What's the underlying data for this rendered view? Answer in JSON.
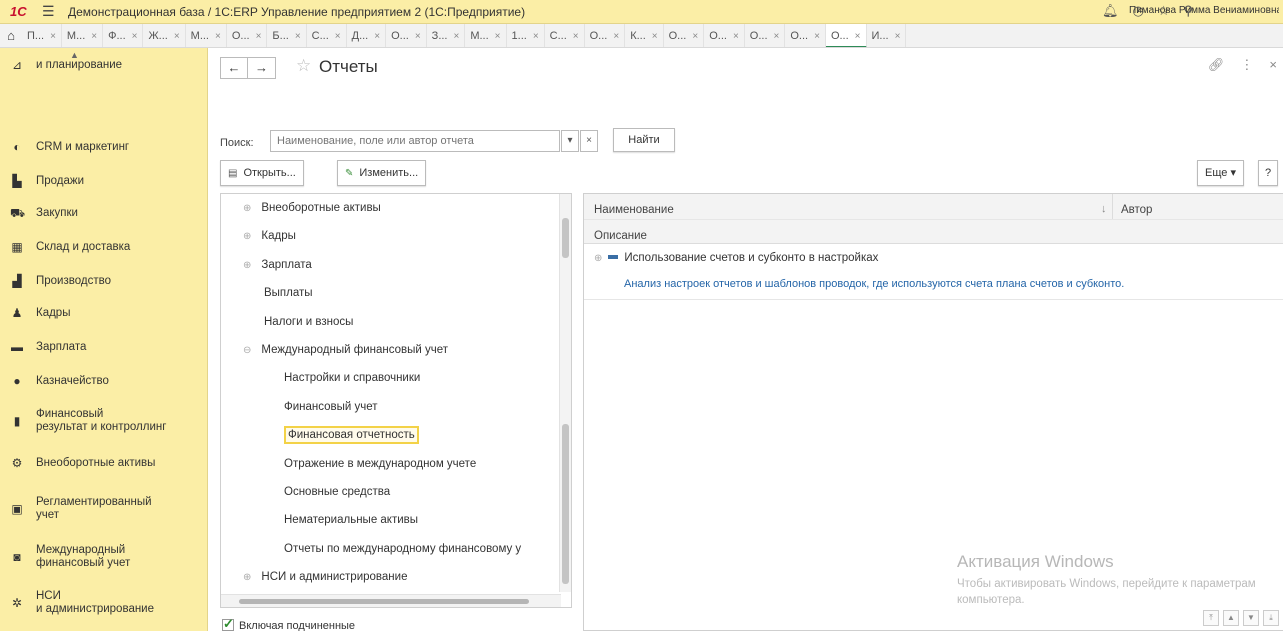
{
  "window": {
    "logo": "1С",
    "title": "Демонстрационная база / 1С:ERP Управление предприятием 2  (1С:Предприятие)",
    "user": "Пиманова Римма Вениаминовна"
  },
  "tabs": [
    "П...",
    "М...",
    "Ф...",
    "Ж...",
    "М...",
    "О...",
    "Б...",
    "С...",
    "Д...",
    "О...",
    "З...",
    "М...",
    "1...",
    "С...",
    "О...",
    "К...",
    "О...",
    "О...",
    "О...",
    "О...",
    "О...",
    "И..."
  ],
  "active_tab_index": 20,
  "sidebar": {
    "items": [
      {
        "label": "и планирование",
        "icon": "planning-icon"
      },
      {
        "label": "CRM и маркетинг",
        "icon": "crm-icon"
      },
      {
        "label": "Продажи",
        "icon": "sales-icon"
      },
      {
        "label": "Закупки",
        "icon": "cart-icon"
      },
      {
        "label": "Склад и доставка",
        "icon": "warehouse-icon"
      },
      {
        "label": "Производство",
        "icon": "factory-icon"
      },
      {
        "label": "Кадры",
        "icon": "person-icon"
      },
      {
        "label": "Зарплата",
        "icon": "salary-icon"
      },
      {
        "label": "Казначейство",
        "icon": "treasury-icon"
      },
      {
        "label": "Финансовый\nрезультат и контроллинг",
        "icon": "bar-chart-icon"
      },
      {
        "label": "Внеоборотные активы",
        "icon": "assets-icon"
      },
      {
        "label": "Регламентированный\nучет",
        "icon": "calculator-icon"
      },
      {
        "label": "Международный\nфинансовый учет",
        "icon": "intl-accounting-icon"
      },
      {
        "label": "НСИ\nи администрирование",
        "icon": "gear-icon"
      }
    ]
  },
  "page": {
    "title": "Отчеты",
    "search_label": "Поиск:",
    "search_placeholder": "Наименование, поле или автор отчета",
    "find_button": "Найти",
    "open_button": "Открыть...",
    "edit_button": "Изменить...",
    "more_button": "Еще",
    "help_button": "?",
    "include_subordinates": "Включая подчиненные"
  },
  "tree": [
    {
      "label": "Внеоборотные активы",
      "level": 0,
      "expander": "⊕"
    },
    {
      "label": "Кадры",
      "level": 0,
      "expander": "⊕"
    },
    {
      "label": "Зарплата",
      "level": 0,
      "expander": "⊕"
    },
    {
      "label": "Выплаты",
      "level": 0,
      "expander": ""
    },
    {
      "label": "Налоги и взносы",
      "level": 0,
      "expander": ""
    },
    {
      "label": "Международный финансовый учет",
      "level": 0,
      "expander": "⊖"
    },
    {
      "label": "Настройки и справочники",
      "level": 1,
      "expander": ""
    },
    {
      "label": "Финансовый учет",
      "level": 1,
      "expander": ""
    },
    {
      "label": "Финансовая отчетность",
      "level": 1,
      "expander": "",
      "selected": true
    },
    {
      "label": "Отражение в международном учете",
      "level": 1,
      "expander": ""
    },
    {
      "label": "Основные средства",
      "level": 1,
      "expander": ""
    },
    {
      "label": "Нематериальные активы",
      "level": 1,
      "expander": ""
    },
    {
      "label": "Отчеты по международному финансовому у",
      "level": 1,
      "expander": ""
    },
    {
      "label": "НСИ и администрирование",
      "level": 0,
      "expander": "⊕"
    }
  ],
  "list": {
    "col_name": "Наименование",
    "col_author": "Автор",
    "col_description": "Описание",
    "items": [
      {
        "name": "Использование счетов и субконто в настройках",
        "description": "Анализ настроек отчетов и шаблонов проводок, где используются счета плана счетов и субконто."
      }
    ]
  },
  "watermark": {
    "title": "Активация Windows",
    "text": "Чтобы активировать Windows, перейдите к параметрам компьютера."
  }
}
